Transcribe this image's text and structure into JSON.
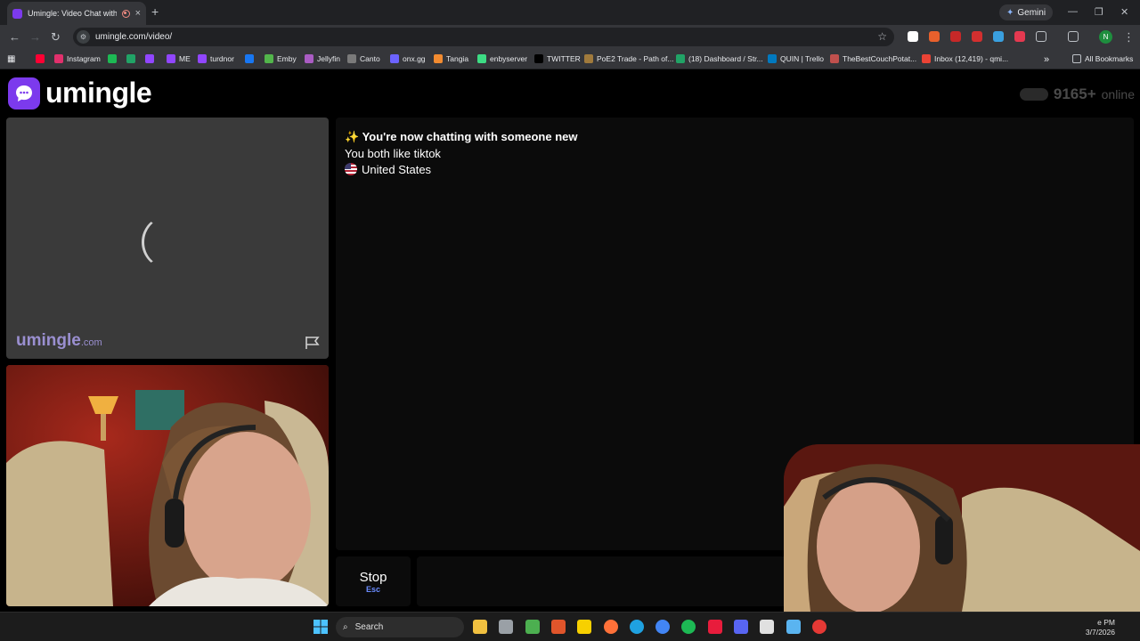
{
  "browser": {
    "tab_title": "Umingle: Video Chat with S",
    "tab_close": "×",
    "new_tab": "+",
    "gemini_label": "Gemini",
    "url": "umingle.com/video/",
    "profile_initial": "N",
    "bookmarks": [
      {
        "label": "",
        "icon_color": "#ff0033"
      },
      {
        "label": "Instagram",
        "icon_color": "#e1306c"
      },
      {
        "label": "",
        "icon_color": "#1db954"
      },
      {
        "label": "",
        "icon_color": "#21a366"
      },
      {
        "label": "",
        "icon_color": "#9146ff"
      },
      {
        "label": "ME",
        "icon_color": "#9146ff"
      },
      {
        "label": "turdnor",
        "icon_color": "#9146ff"
      },
      {
        "label": "",
        "icon_color": "#1877f2"
      },
      {
        "label": "Emby",
        "icon_color": "#52b54b"
      },
      {
        "label": "Jellyfin",
        "icon_color": "#aa5cc3"
      },
      {
        "label": "Canto",
        "icon_color": "#7a7a7a"
      },
      {
        "label": "onx.gg",
        "icon_color": "#6c63ff"
      },
      {
        "label": "Tangia",
        "icon_color": "#f28b30"
      },
      {
        "label": "enbyserver",
        "icon_color": "#3ddc84"
      },
      {
        "label": "TWITTER",
        "icon_color": "#000000"
      },
      {
        "label": "PoE2 Trade - Path of...",
        "icon_color": "#a07a3c"
      },
      {
        "label": "(18) Dashboard / Str...",
        "icon_color": "#21a366"
      },
      {
        "label": "QUIN | Trello",
        "icon_color": "#0079bf"
      },
      {
        "label": "TheBestCouchPotat...",
        "icon_color": "#c0504d"
      },
      {
        "label": "Inbox (12,419) - qmi...",
        "icon_color": "#ea4335"
      }
    ],
    "bookmarks_overflow": "»",
    "all_bookmarks": "All Bookmarks"
  },
  "site": {
    "logo_text": "umingle",
    "online_count": "9165+",
    "online_label": "online",
    "watermark_main": "umingle",
    "watermark_tld": ".com"
  },
  "chat": {
    "line1": "✨ You're now chatting with someone new",
    "line2": "You both like tiktok",
    "line3": "United States"
  },
  "controls": {
    "stop_label": "Stop",
    "stop_key": "Esc"
  },
  "taskbar": {
    "search_placeholder": "Search",
    "time": "e PM",
    "date": "3/7/2026",
    "apps": [
      {
        "name": "file-explorer",
        "color": "#f0c040"
      },
      {
        "name": "clock-app",
        "color": "#9aa0a6"
      },
      {
        "name": "media-app",
        "color": "#4caf50"
      },
      {
        "name": "game-app",
        "color": "#e0552b"
      },
      {
        "name": "sticky-notes",
        "color": "#f7d000"
      },
      {
        "name": "firefox",
        "color": "#ff7139"
      },
      {
        "name": "edge",
        "color": "#1fa1e0"
      },
      {
        "name": "chrome",
        "color": "#4285f4"
      },
      {
        "name": "spotify",
        "color": "#1db954"
      },
      {
        "name": "red-app",
        "color": "#e81c3c"
      },
      {
        "name": "discord",
        "color": "#5865f2"
      },
      {
        "name": "steam",
        "color": "#e0e0e0"
      },
      {
        "name": "notepad",
        "color": "#5ab4f0"
      },
      {
        "name": "record-app",
        "color": "#e53935"
      }
    ]
  }
}
